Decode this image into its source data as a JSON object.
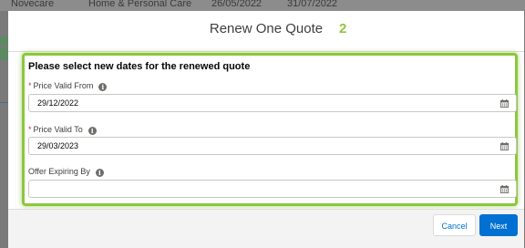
{
  "background_row": {
    "account": "Novecare",
    "category": "Home & Personal Care",
    "date1": "26/05/2022",
    "date2": "31/07/2022"
  },
  "modal": {
    "title": "Renew One Quote",
    "step_number": "2",
    "section_heading": "Please select new dates for the renewed quote",
    "fields": [
      {
        "label": "Price Valid From",
        "required": true,
        "value": "29/12/2022",
        "icon": "calendar-icon"
      },
      {
        "label": "Price Valid To",
        "required": true,
        "value": "29/03/2023",
        "icon": "calendar-icon"
      },
      {
        "label": "Offer Expiring By",
        "required": false,
        "value": "",
        "icon": "calendar-icon"
      }
    ],
    "required_marker": "*",
    "info_glyph": "i"
  },
  "footer": {
    "cancel_label": "Cancel",
    "next_label": "Next"
  },
  "colors": {
    "highlight": "#8dc63f",
    "brand_blue": "#0070d2",
    "required": "#c23934"
  }
}
